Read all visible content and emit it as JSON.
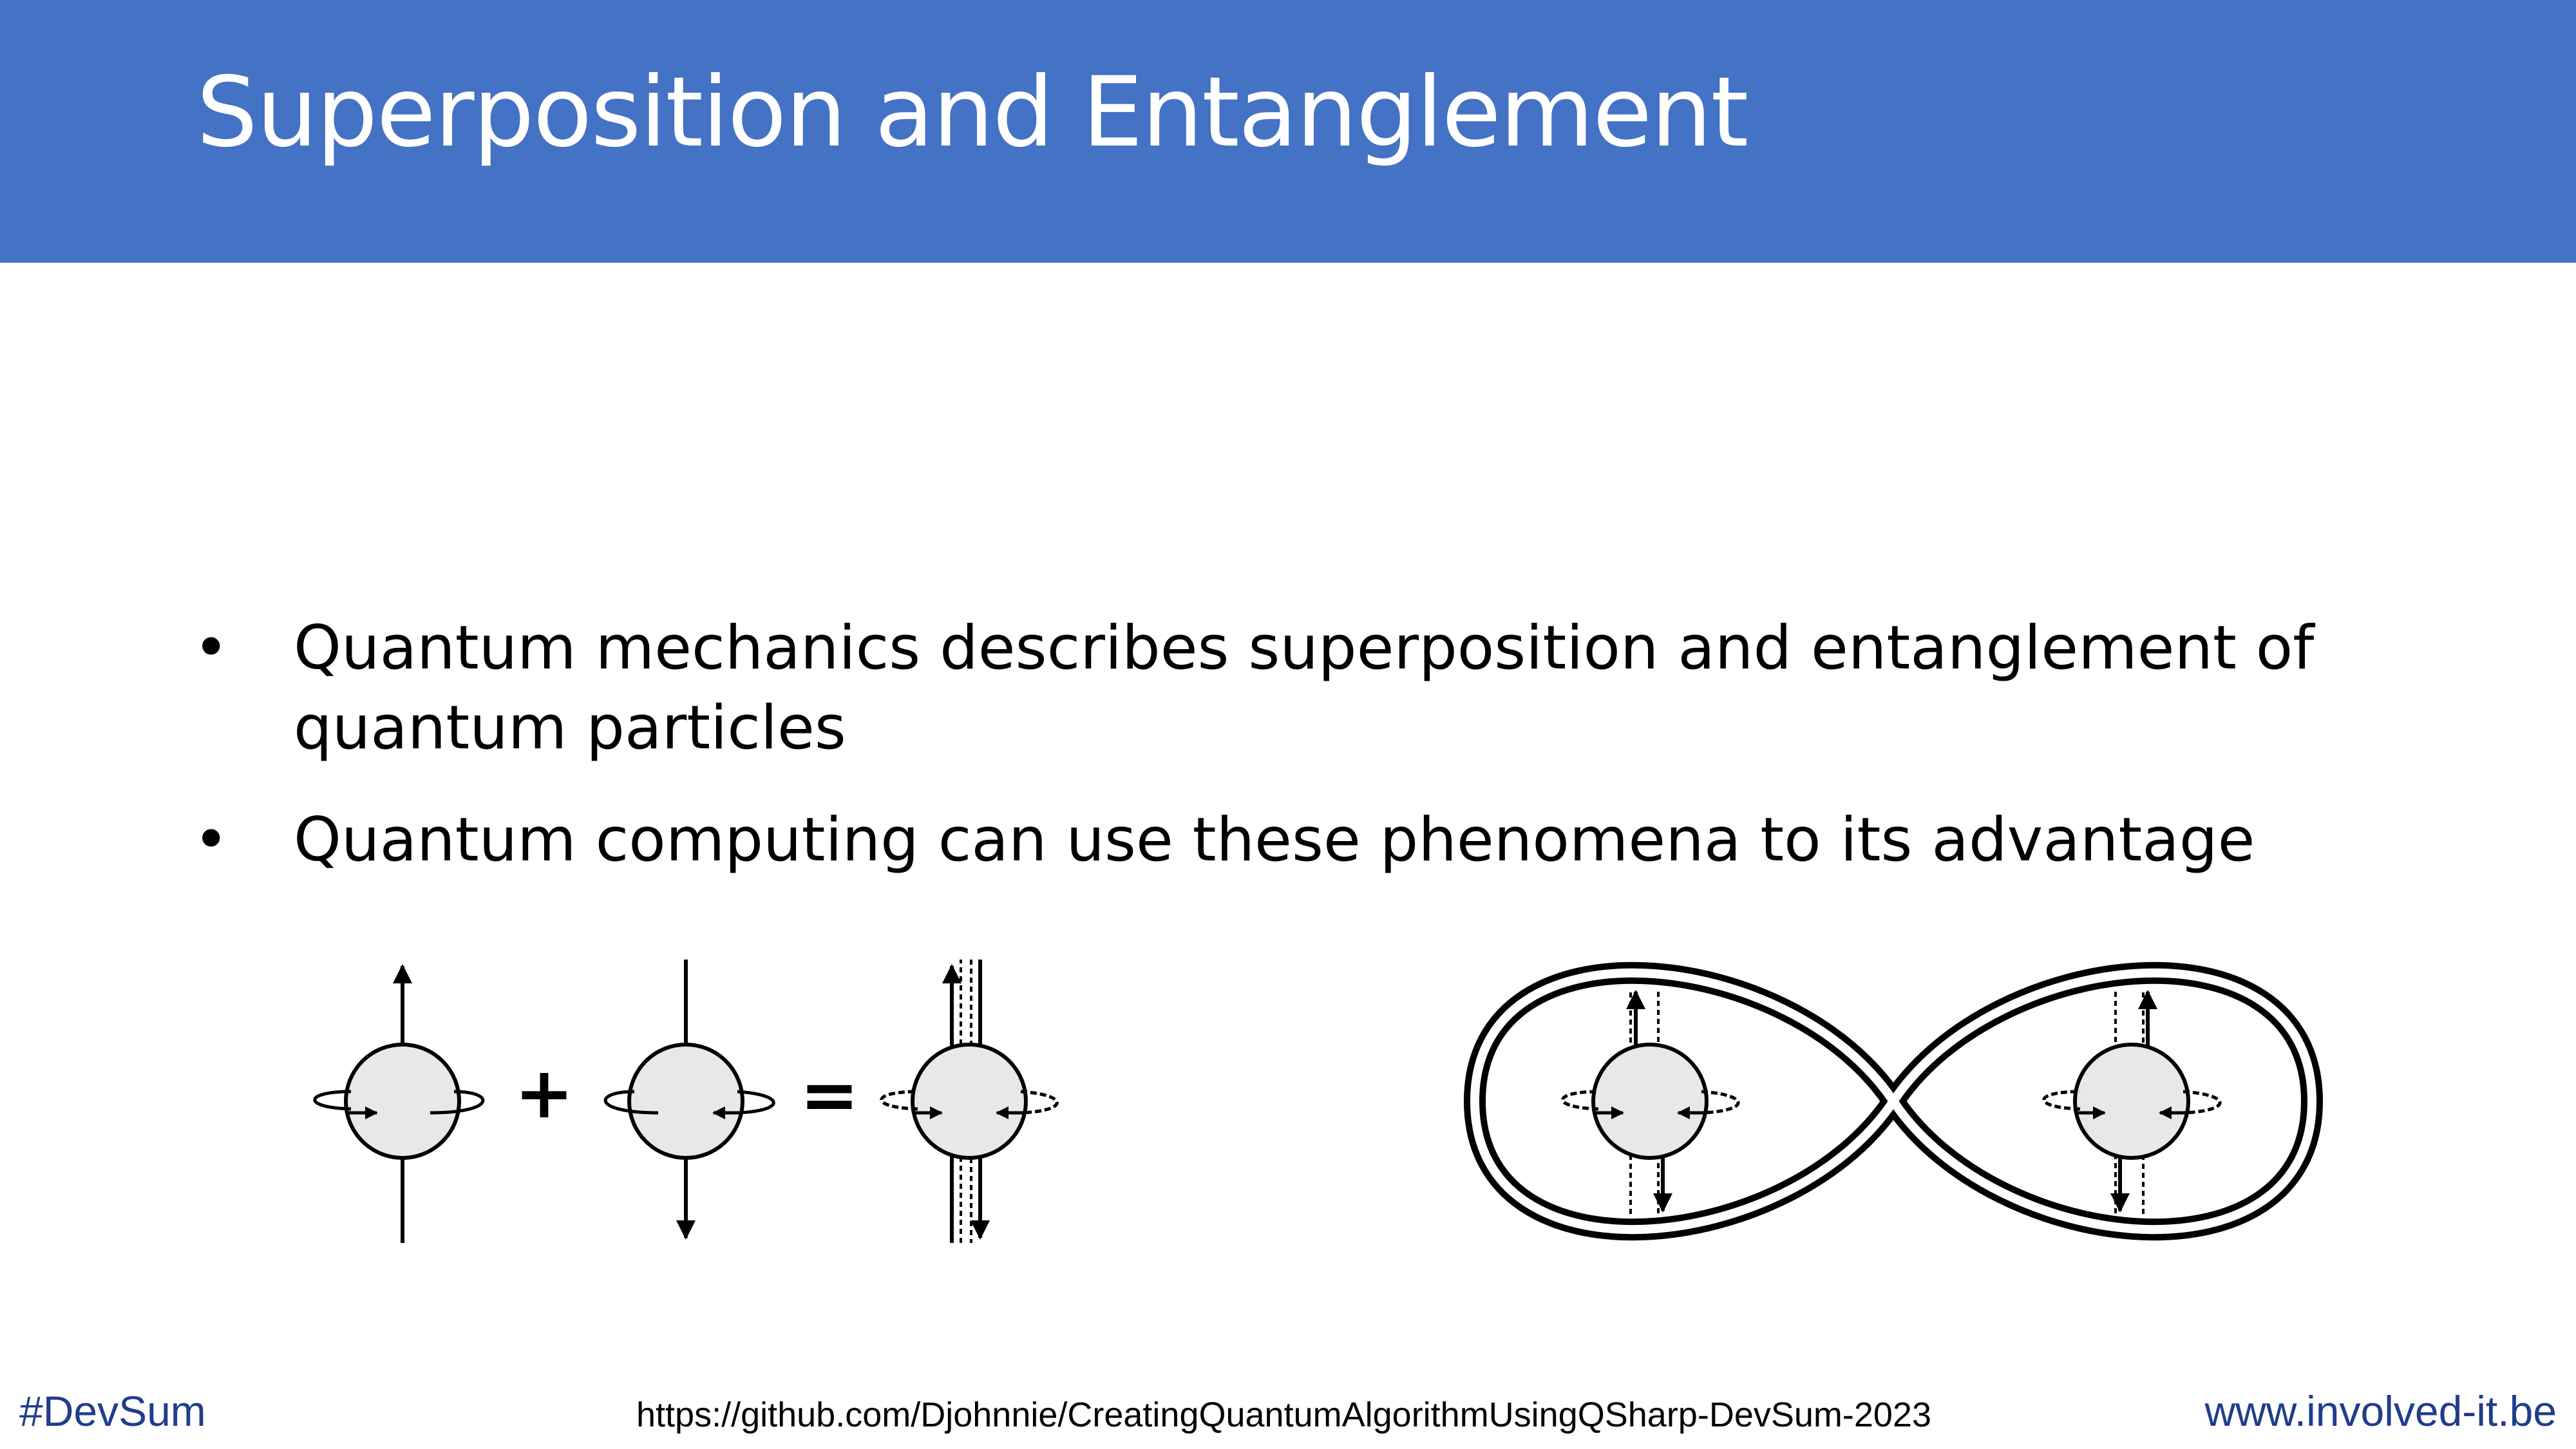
{
  "slide": {
    "title": "Superposition and Entanglement",
    "bullets": [
      {
        "marker": "•",
        "text": "Quantum mechanics describes superposition and entanglement of quantum particles"
      },
      {
        "marker": "•",
        "text": "Quantum computing can use these phenomena to its advantage"
      }
    ],
    "superposition_diagram": {
      "plus_symbol": "+",
      "equals_symbol": "="
    }
  },
  "footer": {
    "hashtag": "#DevSum",
    "url": "https://github.com/Djohnnie/CreatingQuantumAlgorithmUsingQSharp-DevSum-2023",
    "website": "www.involved-it.be"
  },
  "colors": {
    "title_bar": "#4472C4",
    "footer_text": "#1F3D8C",
    "particle_fill": "#E8E8E8"
  },
  "icons": [
    "spin-up-particle-icon",
    "spin-down-particle-icon",
    "superposition-particle-icon",
    "entanglement-loop-icon"
  ]
}
